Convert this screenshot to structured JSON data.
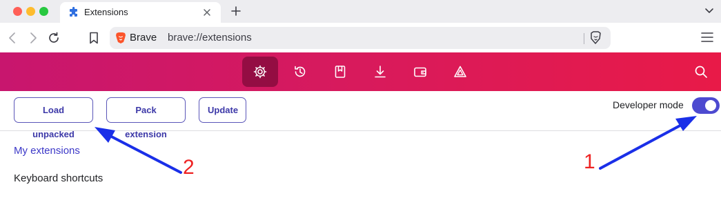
{
  "tab": {
    "title": "Extensions"
  },
  "address_bar": {
    "brand": "Brave",
    "url": "brave://extensions"
  },
  "header": {
    "icons": [
      "settings-icon",
      "history-icon",
      "bookmarks-icon",
      "downloads-icon",
      "wallet-icon",
      "rewards-icon"
    ],
    "active": "settings-icon"
  },
  "toolbar": {
    "load_unpacked": "Load unpacked",
    "pack_extension": "Pack extension",
    "update": "Update",
    "developer_mode_label": "Developer mode",
    "developer_mode_on": true
  },
  "sidebar": {
    "my_extensions": "My extensions",
    "keyboard_shortcuts": "Keyboard shortcuts"
  },
  "annotations": {
    "marker_1": "1",
    "marker_2": "2",
    "arrow_color": "#1a2fe8",
    "number_color": "#ee2222"
  },
  "colors": {
    "accent": "#4d4ad0",
    "header_start": "#c8166e",
    "header_end": "#e81a48"
  }
}
